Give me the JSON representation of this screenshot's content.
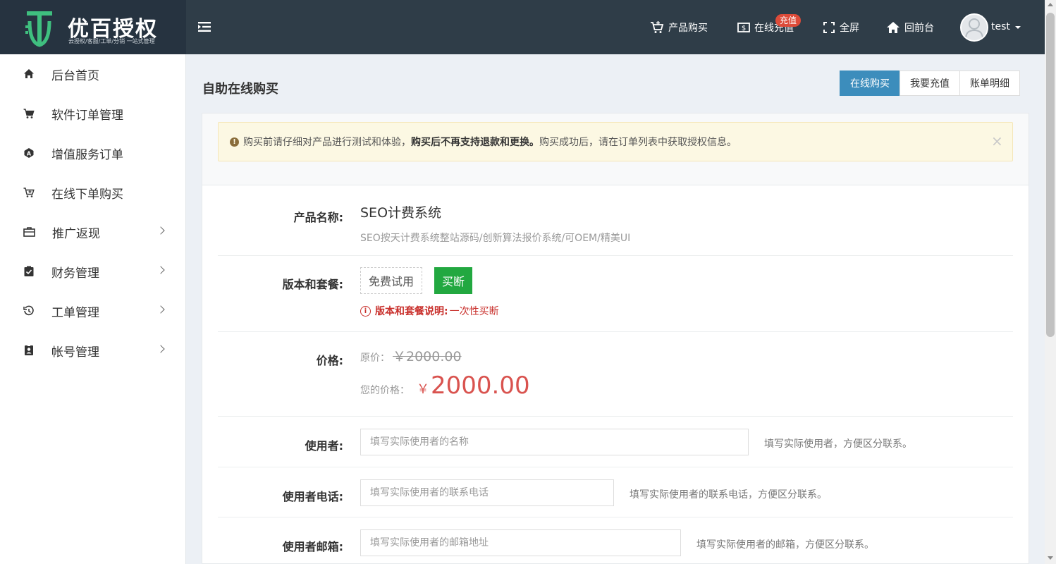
{
  "brand": {
    "title": "优百授权",
    "subtitle": "云授权/客服/工单/分销 一站式管理"
  },
  "topnav": {
    "product_buy": "产品购买",
    "online_recharge": "在线充值",
    "recharge_badge": "充值",
    "fullscreen": "全屏",
    "back_to_front": "回前台",
    "username": "test"
  },
  "sidebar": {
    "items": [
      {
        "label": "后台首页",
        "icon": "home-icon"
      },
      {
        "label": "软件订单管理",
        "icon": "cart-icon"
      },
      {
        "label": "增值服务订单",
        "icon": "service-icon"
      },
      {
        "label": "在线下单购买",
        "icon": "cart-plus-icon"
      },
      {
        "label": "推广返现",
        "icon": "briefcase-icon"
      },
      {
        "label": "财务管理",
        "icon": "clipboard-check-icon"
      },
      {
        "label": "工单管理",
        "icon": "history-icon"
      },
      {
        "label": "帐号管理",
        "icon": "id-badge-icon"
      }
    ]
  },
  "page": {
    "title": "自助在线购买",
    "tabs": [
      "在线购买",
      "我要充值",
      "账单明细"
    ]
  },
  "alert": {
    "before": "购买前请仔细对产品进行测试和体验，",
    "bold": "购买后不再支持退款和更换。",
    "after": "购买成功后，请在订单列表中获取授权信息。",
    "close": "×"
  },
  "product": {
    "label": "产品名称:",
    "name": "SEO计费系统",
    "description": "SEO按天计费系统整站源码/创新算法报价系统/可OEM/精美UI"
  },
  "plan": {
    "label": "版本和套餐:",
    "options": [
      "免费试用",
      "买断"
    ],
    "selected": "买断",
    "note_label": "版本和套餐说明:",
    "note_value": "一次性买断"
  },
  "price": {
    "label": "价格:",
    "original_label": "原价：",
    "original_value": "￥2000.00",
    "your_label": "您的价格：",
    "currency": "￥",
    "your_value": "2000.00"
  },
  "form": {
    "user": {
      "label": "使用者:",
      "placeholder": "填写实际使用者的名称",
      "hint": "填写实际使用者，方便区分联系。"
    },
    "phone": {
      "label": "使用者电话:",
      "placeholder": "填写实际使用者的联系电话",
      "hint": "填写实际使用者的联系电话，方便区分联系。"
    },
    "email": {
      "label": "使用者邮箱:",
      "placeholder": "填写实际使用者的邮箱地址",
      "hint": "填写实际使用者的邮箱，方便区分联系。"
    }
  }
}
